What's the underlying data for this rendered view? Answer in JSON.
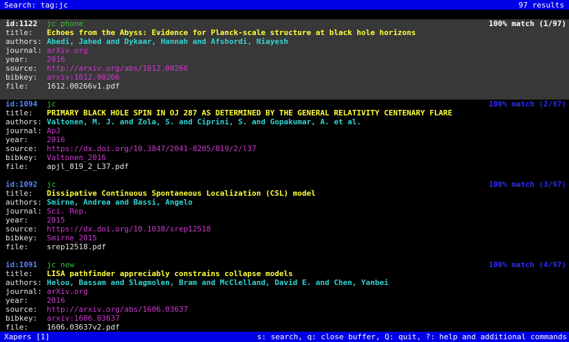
{
  "search": {
    "label": "Search: tag:jc",
    "results": "97 results"
  },
  "labels": {
    "title": "title:",
    "authors": "authors:",
    "journal": "journal:",
    "year": "year:",
    "source": "source:",
    "bibkey": "bibkey:",
    "file": "file:"
  },
  "records": [
    {
      "id": "id:1122",
      "tags": "jc phone",
      "match": "100% match (1/97)",
      "title": "Echoes from the Abyss: Evidence for Planck-scale structure at black hole horizons",
      "authors": "Abedi, Jahed and Dykaar, Hannah and Afshordi, Niayesh",
      "journal": "arXiv.org",
      "year": "2016",
      "source": "http://arxiv.org/abs/1612.00266",
      "bibkey": "arxiv:1612.00266",
      "file": "1612.00266v1.pdf"
    },
    {
      "id": "id:1094",
      "tags": "jc",
      "match": "100% match (2/97)",
      "title": "PRIMARY BLACK HOLE SPIN IN OJ 287 AS DETERMINED BY THE GENERAL RELATIVITY CENTENARY FLARE",
      "authors": "Valtonen, M. J. and Zola, S. and Ciprini, S. and Gopakumar, A. et al.",
      "journal": "ApJ",
      "year": "2016",
      "source": "https://dx.doi.org/10.3847/2041-8205/819/2/l37",
      "bibkey": "Valtonen_2016",
      "file": "apjl_819_2_L37.pdf"
    },
    {
      "id": "id:1092",
      "tags": "jc",
      "match": "100% match (3/97)",
      "title": "Dissipative Continuous Spontaneous Localization (CSL) model",
      "authors": "Smirne, Andrea and Bassi, Angelo",
      "journal": "Sci. Rep.",
      "year": "2015",
      "source": "https://dx.doi.org/10.1038/srep12518",
      "bibkey": "Smirne_2015",
      "file": "srep12518.pdf"
    },
    {
      "id": "id:1091",
      "tags": "jc new",
      "match": "100% match (4/97)",
      "title": "LISA pathfinder appreciably constrains collapse models",
      "authors": "Helou, Bassam and Slagmolen, Bram and McClelland, David E. and Chen, Yanbei",
      "journal": "arXiv.org",
      "year": "2016",
      "source": "http://arxiv.org/abs/1606.03637",
      "bibkey": "arxiv:1606.03637",
      "file": "1606.03637v2.pdf"
    }
  ],
  "status": {
    "buffer": "Xapers [1]",
    "help": "s: search, q: close buffer, Q: quit, ?: help and additional commands"
  },
  "colors": {
    "bar": "#0000e6",
    "selected_bg": "#383838",
    "id": "#5b83ff",
    "tags": "#34c234",
    "title": "#ffff3a",
    "authors": "#32d4d4",
    "meta": "#d238d2"
  }
}
